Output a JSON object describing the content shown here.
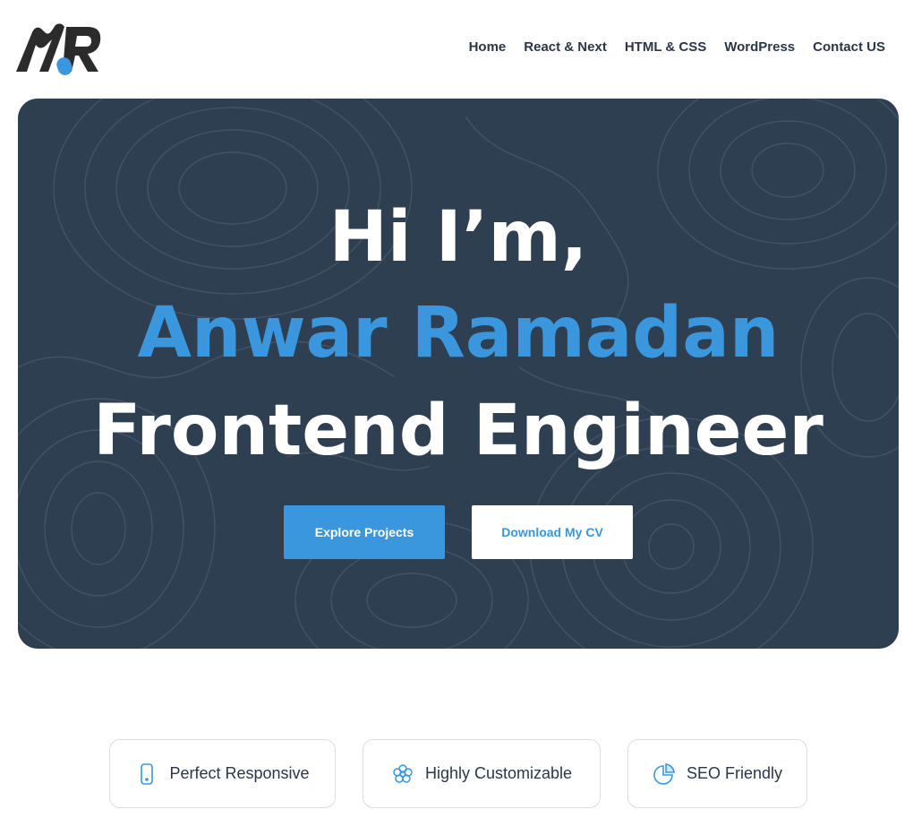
{
  "brand": {
    "logo_text": "MR",
    "accent_color": "#3a96dd",
    "dark_color": "#2b2b2b"
  },
  "nav": {
    "items": [
      {
        "label": "Home"
      },
      {
        "label": "React & Next"
      },
      {
        "label": "HTML & CSS"
      },
      {
        "label": "WordPress"
      },
      {
        "label": "Contact US"
      }
    ]
  },
  "hero": {
    "line1": "Hi I’m,",
    "line2": "Anwar Ramadan",
    "line3": "Frontend Engineer",
    "background_color": "#2f3f52",
    "primary_button": "Explore Projects",
    "secondary_button": "Download My CV"
  },
  "features": [
    {
      "label": "Perfect Responsive",
      "icon": "mobile-phone-icon"
    },
    {
      "label": "Highly Customizable",
      "icon": "flower-gear-icon"
    },
    {
      "label": "SEO Friendly",
      "icon": "pie-chart-icon"
    }
  ]
}
